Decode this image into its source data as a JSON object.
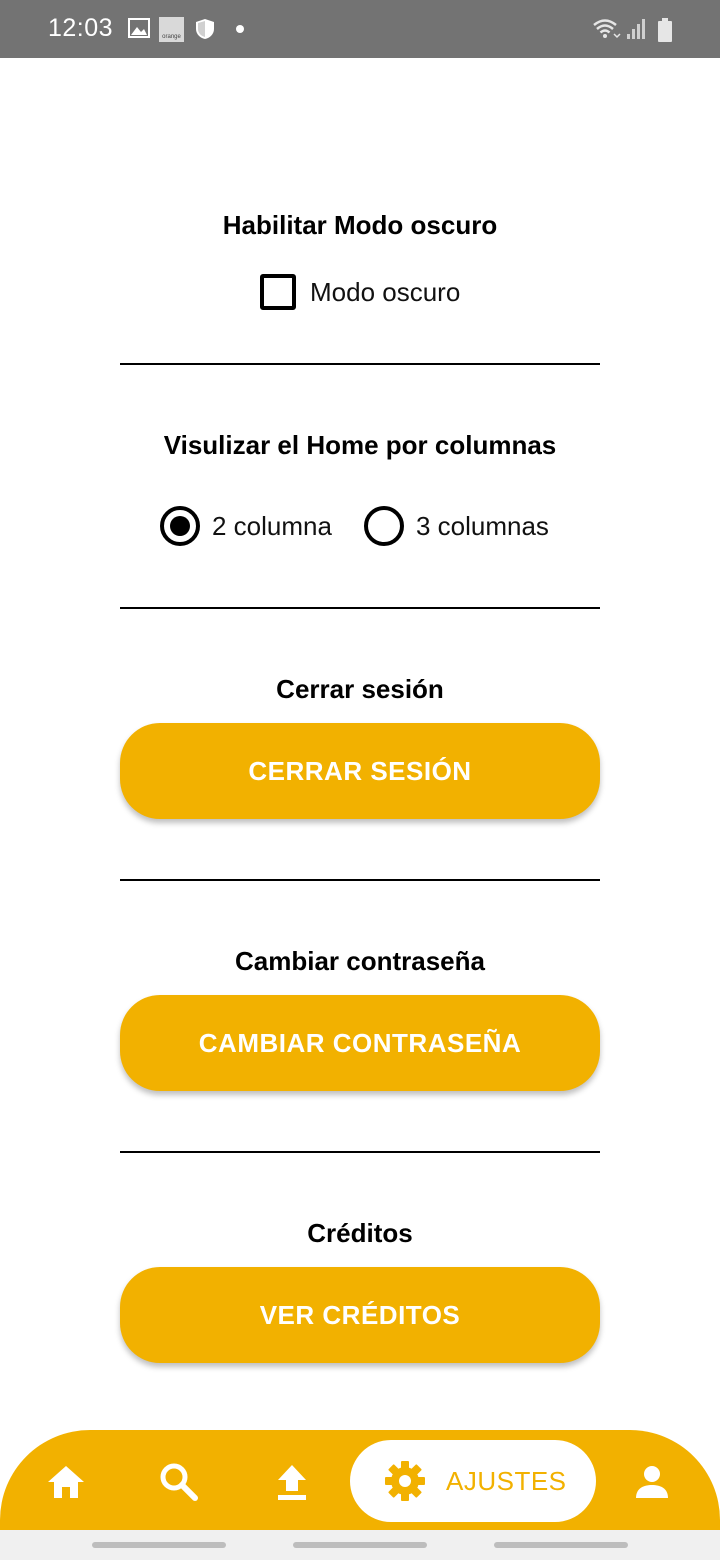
{
  "status_bar": {
    "time": "12:03",
    "icons": [
      "gallery-icon",
      "orange-icon",
      "shield-icon",
      "notification-dot-icon",
      "wifi-icon",
      "signal-icon",
      "battery-icon"
    ],
    "carrier_badge": "orange"
  },
  "settings": {
    "dark_mode": {
      "title": "Habilitar Modo oscuro",
      "checkbox_label": "Modo oscuro",
      "checked": false
    },
    "columns": {
      "title": "Visulizar el Home por columnas",
      "options": [
        {
          "label": "2 columna",
          "selected": true
        },
        {
          "label": "3 columnas",
          "selected": false
        }
      ]
    },
    "logout": {
      "title": "Cerrar sesión",
      "button": "CERRAR SESIÓN"
    },
    "change_password": {
      "title": "Cambiar contraseña",
      "button": "CAMBIAR CONTRASEÑA"
    },
    "credits": {
      "title": "Créditos",
      "button": "VER CRÉDITOS"
    }
  },
  "bottom_nav": {
    "items": [
      {
        "icon": "home-icon"
      },
      {
        "icon": "search-icon"
      },
      {
        "icon": "upload-icon"
      },
      {
        "icon": "gear-icon",
        "label": "AJUSTES",
        "active": true
      },
      {
        "icon": "person-icon"
      }
    ]
  },
  "colors": {
    "accent": "#f2b100",
    "status_bar": "#737373"
  }
}
